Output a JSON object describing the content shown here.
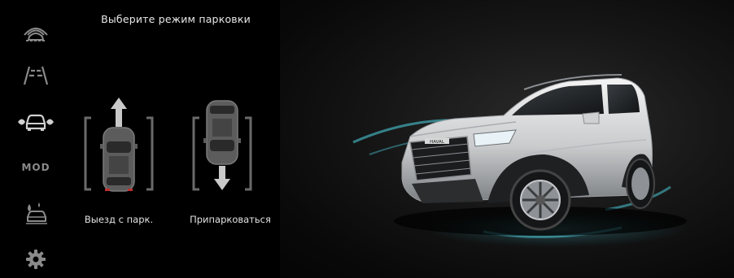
{
  "sidebar": {
    "items": [
      {
        "name": "parking-radar",
        "icon": "parking-radar-icon",
        "active": false
      },
      {
        "name": "lane-assist",
        "icon": "lane-lines-icon",
        "active": false
      },
      {
        "name": "auto-parking",
        "icon": "car-sensor-icon",
        "active": true
      },
      {
        "name": "mode",
        "label": "MOD",
        "active": false
      },
      {
        "name": "car-wash",
        "icon": "car-wash-icon",
        "active": false
      },
      {
        "name": "settings",
        "icon": "gear-icon",
        "active": false
      }
    ]
  },
  "parking": {
    "title": "Выберите режим парковки",
    "modes": [
      {
        "label": "Выезд с парк.",
        "arrow": "up"
      },
      {
        "label": "Припарковаться",
        "arrow": "down"
      }
    ]
  },
  "hero": {
    "badge": "HAVAL"
  },
  "colors": {
    "background": "#000000",
    "icon": "#8a8a8a",
    "icon_active": "#d0d0d0",
    "text": "#e6e6e6",
    "accent_glow": "#4fd8e8"
  }
}
